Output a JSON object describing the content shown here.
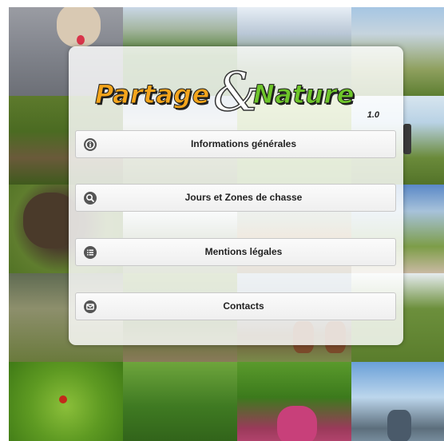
{
  "app": {
    "logo_left": "Partage",
    "logo_amp": "&",
    "logo_right": "Nature",
    "version": "1.0"
  },
  "menu": {
    "items": [
      {
        "label": "Informations générales",
        "icon": "info-icon"
      },
      {
        "label": "Jours et Zones de chasse",
        "icon": "search-icon"
      },
      {
        "label": "Mentions légales",
        "icon": "list-icon"
      },
      {
        "label": "Contacts",
        "icon": "mail-icon"
      }
    ]
  },
  "colors": {
    "logo_orange": "#f4a51c",
    "logo_green": "#6ec52a",
    "icon_bg": "#555555"
  }
}
